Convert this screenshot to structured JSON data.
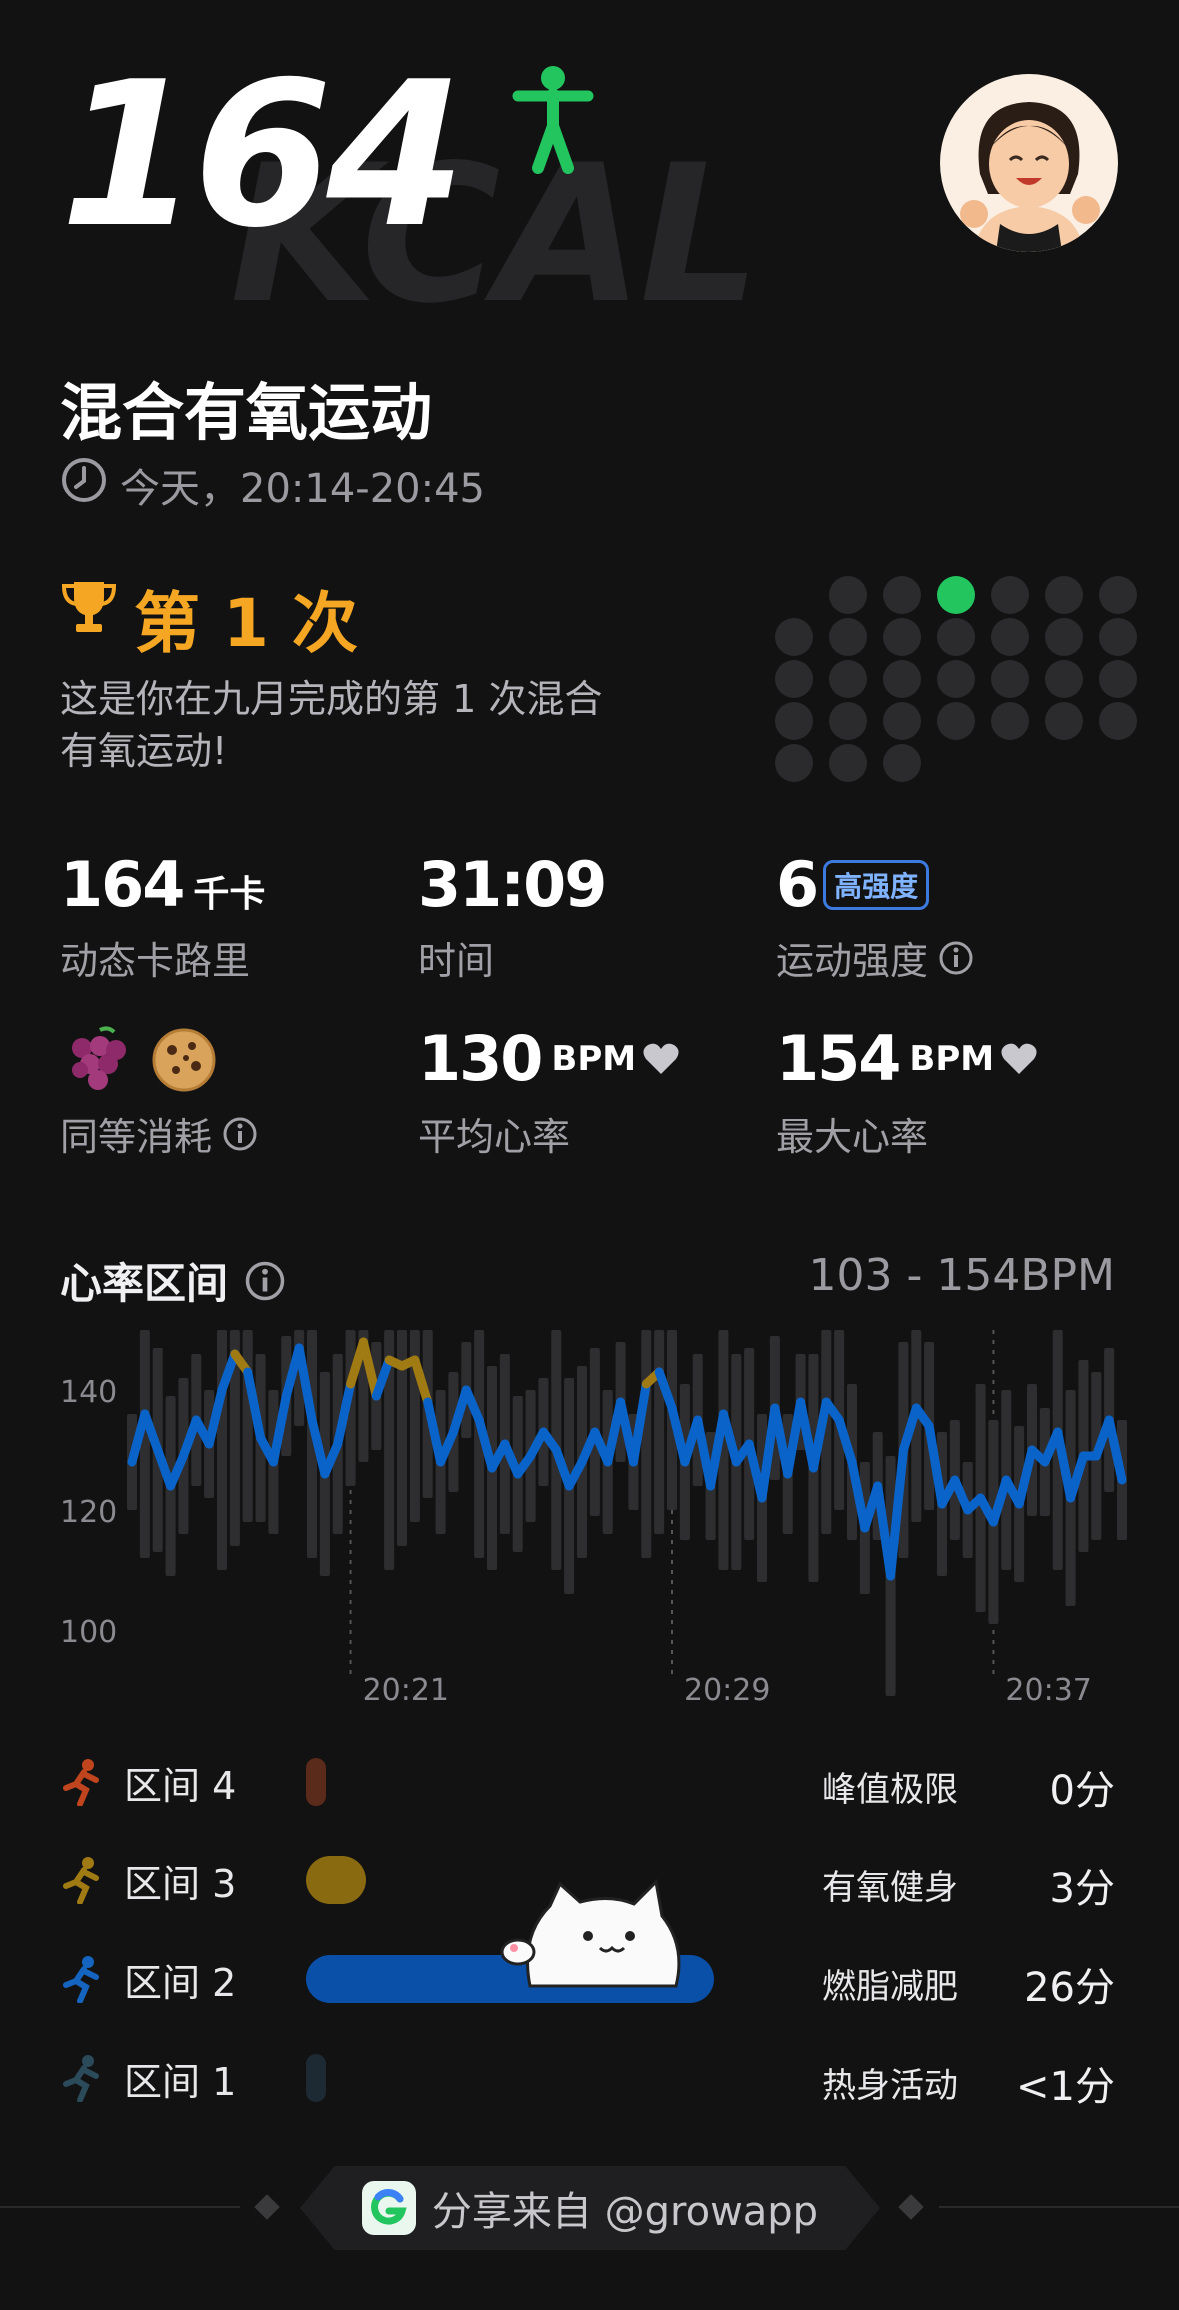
{
  "header": {
    "calories": "164",
    "calories_unit_bg": "KCAL",
    "title": "混合有氧运动",
    "time_range": "今天，20:14-20:45"
  },
  "achievement": {
    "rank": "第 1 次",
    "description_line1": "这是你在九月完成的第 1 次混合",
    "description_line2": "有氧运动!"
  },
  "stats": {
    "calories_value": "164",
    "calories_unit": "千卡",
    "calories_label": "动态卡路里",
    "duration_value": "31:09",
    "duration_label": "时间",
    "intensity_value": "6",
    "intensity_badge": "高强度",
    "intensity_label": "运动强度",
    "equivalent_label": "同等消耗",
    "avg_hr_value": "130",
    "avg_hr_unit": "BPM",
    "avg_hr_label": "平均心率",
    "max_hr_value": "154",
    "max_hr_unit": "BPM",
    "max_hr_label": "最大心率"
  },
  "hr_section": {
    "title": "心率区间",
    "range": "103 - 154BPM",
    "y_ticks": [
      "140",
      "120",
      "100"
    ],
    "x_ticks": [
      "20:21",
      "20:29",
      "20:37"
    ]
  },
  "zones": [
    {
      "label": "区间 4",
      "name": "峰值极限",
      "time": "0分",
      "color": "#5a2a1a",
      "fraction": 0.0
    },
    {
      "label": "区间 3",
      "name": "有氧健身",
      "time": "3分",
      "color": "#8a6a10",
      "fraction": 0.1
    },
    {
      "label": "区间 2",
      "name": "燃脂减肥",
      "time": "26分",
      "color": "#0a4fa8",
      "fraction": 0.87
    },
    {
      "label": "区间 1",
      "name": "热身活动",
      "time": "<1分",
      "color": "#1e2a33",
      "fraction": 0.01
    }
  ],
  "footer": {
    "share_text": "分享来自 @growapp"
  },
  "colors": {
    "accent_green": "#22c55e",
    "accent_gold": "#f5a623",
    "line_blue": "#0a63c9",
    "zone3_gold": "#a07a12"
  },
  "chart_data": {
    "type": "line",
    "title": "心率区间",
    "xlabel": "",
    "ylabel": "",
    "ylim": [
      100,
      150
    ],
    "x_ticks": [
      "20:21",
      "20:29",
      "20:37"
    ],
    "series": [
      {
        "values": [
          128,
          136,
          130,
          124,
          129,
          135,
          131,
          140,
          146,
          143,
          132,
          128,
          139,
          147,
          135,
          126,
          131,
          141,
          148,
          139,
          145,
          144,
          145,
          138,
          128,
          133,
          140,
          135,
          127,
          131,
          126,
          129,
          133,
          130,
          124,
          128,
          133,
          128,
          138,
          128,
          141,
          143,
          137,
          128,
          135,
          124,
          136,
          128,
          131,
          122,
          137,
          126,
          138,
          127,
          138,
          135,
          128,
          117,
          124,
          109,
          130,
          137,
          134,
          121,
          125,
          120,
          122,
          118,
          125,
          121,
          130,
          128,
          133,
          122,
          129,
          129,
          135,
          125
        ]
      }
    ]
  }
}
